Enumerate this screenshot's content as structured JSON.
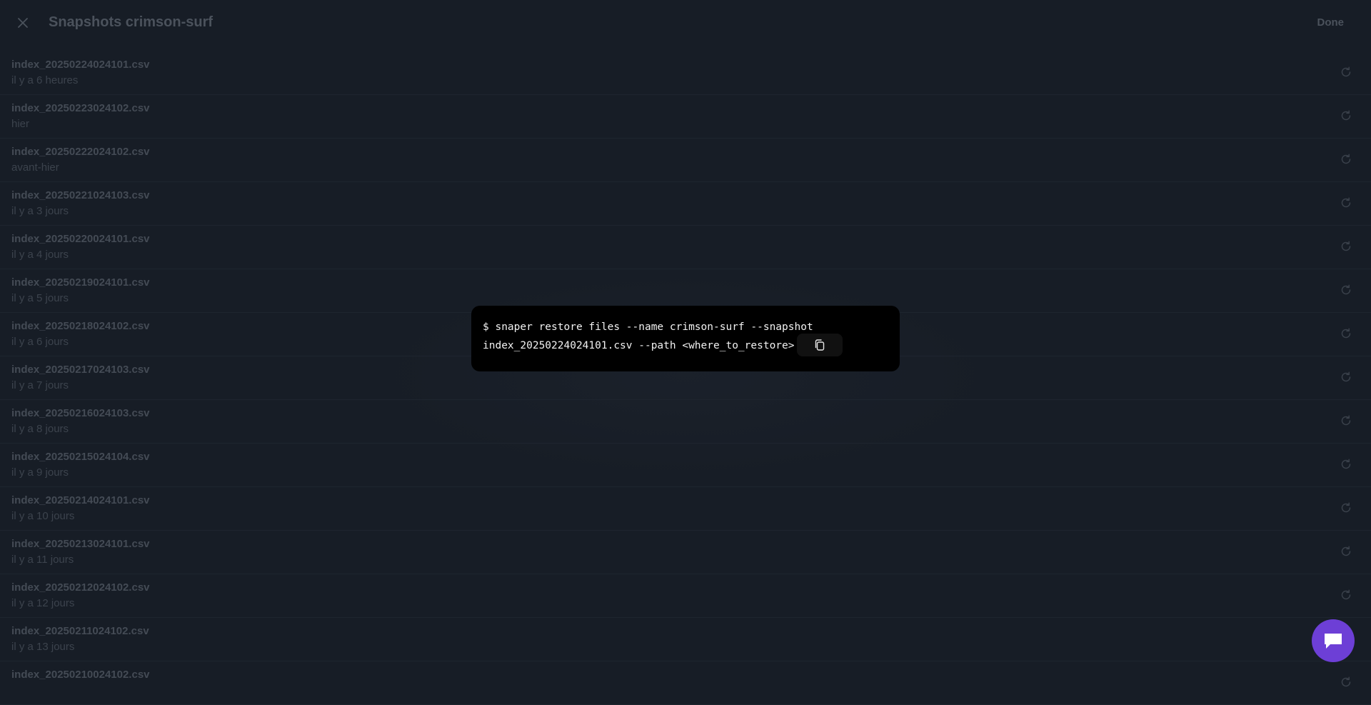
{
  "header": {
    "title": "Snapshots crimson-surf",
    "done_label": "Done",
    "close_icon": "close-icon"
  },
  "snapshots": [
    {
      "file": "index_20250224024101.csv",
      "when": "il y a 6 heures"
    },
    {
      "file": "index_20250223024102.csv",
      "when": "hier"
    },
    {
      "file": "index_20250222024102.csv",
      "when": "avant-hier"
    },
    {
      "file": "index_20250221024103.csv",
      "when": "il y a 3 jours"
    },
    {
      "file": "index_20250220024101.csv",
      "when": "il y a 4 jours"
    },
    {
      "file": "index_20250219024101.csv",
      "when": "il y a 5 jours"
    },
    {
      "file": "index_20250218024102.csv",
      "when": "il y a 6 jours"
    },
    {
      "file": "index_20250217024103.csv",
      "when": "il y a 7 jours"
    },
    {
      "file": "index_20250216024103.csv",
      "when": "il y a 8 jours"
    },
    {
      "file": "index_20250215024104.csv",
      "when": "il y a 9 jours"
    },
    {
      "file": "index_20250214024101.csv",
      "when": "il y a 10 jours"
    },
    {
      "file": "index_20250213024101.csv",
      "when": "il y a 11 jours"
    },
    {
      "file": "index_20250212024102.csv",
      "when": "il y a 12 jours"
    },
    {
      "file": "index_20250211024102.csv",
      "when": "il y a 13 jours"
    },
    {
      "file": "index_20250210024102.csv",
      "when": ""
    }
  ],
  "command": {
    "line1": "$ snaper restore files --name crimson-surf --snapshot",
    "line2": "index_20250224024101.csv --path <where_to_restore>"
  },
  "icons": {
    "restore": "refresh-icon",
    "copy": "copy-icon",
    "chat": "chat-icon"
  },
  "colors": {
    "background": "#171d26",
    "accent": "#6d3fd6",
    "command_bg": "#000000"
  }
}
